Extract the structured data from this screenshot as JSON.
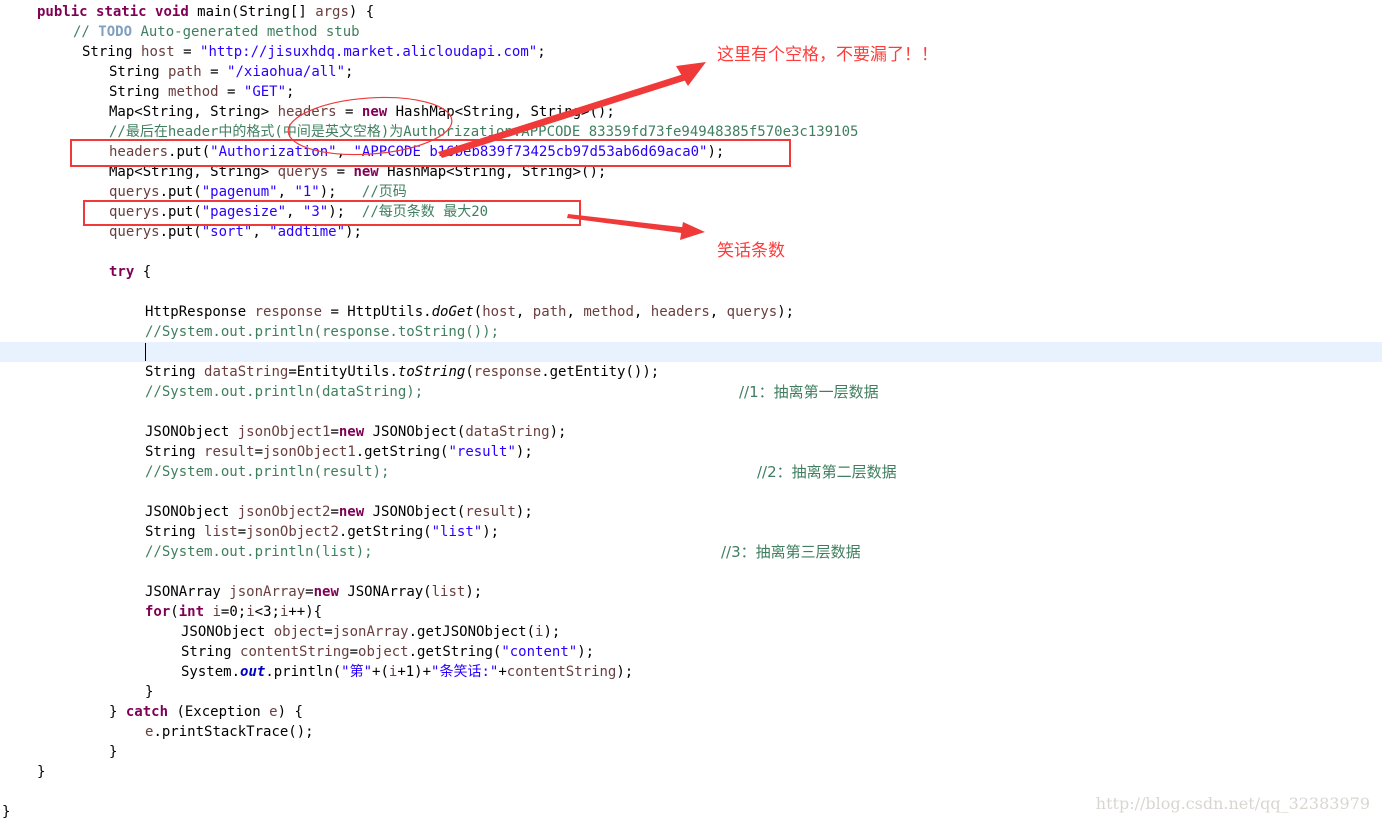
{
  "code": {
    "l1": {
      "kw1": "public",
      "kw2": "static",
      "kw3": "void",
      "rest": " main(String[] ",
      "var": "args",
      "end": ") {"
    },
    "l2": {
      "pre": "// ",
      "todo": "TODO",
      "rest": " Auto-generated method stub"
    },
    "l3": {
      "type": "String ",
      "var": "host",
      "eq": " = ",
      "str": "\"http://jisuxhdq.market.alicloudapi.com\"",
      "end": ";"
    },
    "l4": {
      "type": "String ",
      "var": "path",
      "eq": " = ",
      "str": "\"/xiaohua/all\"",
      "end": ";"
    },
    "l5": {
      "type": "String ",
      "var": "method",
      "eq": " = ",
      "str": "\"GET\"",
      "end": ";"
    },
    "l6": {
      "type": "Map<String, String> ",
      "var": "headers",
      "eq": " = ",
      "kw": "new",
      "rest": " HashMap<String, String>();"
    },
    "l7": {
      "comment": "//最后在header中的格式(中间是英文空格)为Authorization:APPCODE 83359fd73fe94948385f570e3c139105"
    },
    "l8": {
      "var": "headers",
      "call": ".put(",
      "s1": "\"Authorization\"",
      "sep": ", ",
      "s2": "\"APPCODE b16beb839f73425cb97d53ab6d69aca0\"",
      "end": ");"
    },
    "l9": {
      "type": "Map<String, String> ",
      "var": "querys",
      "eq": " = ",
      "kw": "new",
      "rest": " HashMap<String, String>();"
    },
    "l10": {
      "var": "querys",
      "call": ".put(",
      "s1": "\"pagenum\"",
      "sep": ", ",
      "s2": "\"1\"",
      "end": ");   ",
      "comment": "//页码"
    },
    "l11": {
      "var": "querys",
      "call": ".put(",
      "s1": "\"pagesize\"",
      "sep": ", ",
      "s2": "\"3\"",
      "end": ");  ",
      "comment": "//每页条数 最大20"
    },
    "l12": {
      "var": "querys",
      "call": ".put(",
      "s1": "\"sort\"",
      "sep": ", ",
      "s2": "\"addtime\"",
      "end": ");"
    },
    "l14": {
      "kw": "try",
      "rest": " {"
    },
    "l16": {
      "type": "HttpResponse ",
      "var": "response",
      "eq": " = HttpUtils.",
      "it": "doGet",
      "args": "(",
      "a1": "host",
      "c1": ", ",
      "a2": "path",
      "c2": ", ",
      "a3": "method",
      "c3": ", ",
      "a4": "headers",
      "c4": ", ",
      "a5": "querys",
      "end": ");"
    },
    "l17": {
      "comment": "//System.out.println(response.toString());"
    },
    "l19": {
      "type": "String ",
      "var": "dataString",
      "eq": "=EntityUtils.",
      "it": "toString",
      "args": "(",
      "a1": "response",
      "end": ".getEntity());"
    },
    "l20": {
      "comment": "//System.out.println(dataString);",
      "note": "//1：抽离第一层数据"
    },
    "l22": {
      "type": "JSONObject ",
      "var": "jsonObject1",
      "eq": "=",
      "kw": "new",
      "rest": " JSONObject(",
      "a1": "dataString",
      "end": ");"
    },
    "l23": {
      "type": "String ",
      "var": "result",
      "eq": "=",
      "v2": "jsonObject1",
      "rest": ".getString(",
      "str": "\"result\"",
      "end": ");"
    },
    "l24": {
      "comment": "//System.out.println(result);",
      "note": "//2：抽离第二层数据"
    },
    "l26": {
      "type": "JSONObject ",
      "var": "jsonObject2",
      "eq": "=",
      "kw": "new",
      "rest": " JSONObject(",
      "a1": "result",
      "end": ");"
    },
    "l27": {
      "type": "String ",
      "var": "list",
      "eq": "=",
      "v2": "jsonObject2",
      "rest": ".getString(",
      "str": "\"list\"",
      "end": ");"
    },
    "l28": {
      "comment": "//System.out.println(list);",
      "note": "//3：抽离第三层数据"
    },
    "l30": {
      "type": "JSONArray ",
      "var": "jsonArray",
      "eq": "=",
      "kw": "new",
      "rest": " JSONArray(",
      "a1": "list",
      "end": ");"
    },
    "l31": {
      "kw1": "for",
      "p": "(",
      "kw2": "int",
      "rest": " ",
      "v": "i",
      "r2": "=0;",
      "v2": "i",
      "r3": "<3;",
      "v3": "i",
      "end": "++){"
    },
    "l32": {
      "type": "JSONObject ",
      "var": "object",
      "eq": "=",
      "v2": "jsonArray",
      "rest": ".getJSONObject(",
      "a1": "i",
      "end": ");"
    },
    "l33": {
      "type": "String ",
      "var": "contentString",
      "eq": "=",
      "v2": "object",
      "rest": ".getString(",
      "str": "\"content\"",
      "end": ");"
    },
    "l34": {
      "pre": "System.",
      "fld": "out",
      "rest": ".println(",
      "s1": "\"第\"",
      "m1": "+(",
      "v": "i",
      "m2": "+1)+",
      "s2": "\"条笑话:\"",
      "m3": "+",
      "v2": "contentString",
      "end": ");"
    },
    "l35": {
      "text": "}"
    },
    "l36": {
      "pre": "} ",
      "kw": "catch",
      "rest": " (Exception ",
      "v": "e",
      "end": ") {"
    },
    "l37": {
      "v": "e",
      "rest": ".printStackTrace();"
    },
    "l38": {
      "text": "}"
    },
    "l39": {
      "text": "}"
    },
    "l41": {
      "text": "}"
    }
  },
  "annotations": {
    "space_note": "这里有个空格，不要漏了！！",
    "count_note": "笑话条数"
  },
  "watermark": "http://blog.csdn.net/qq_32383979",
  "colors": {
    "keyword": "#7f0055",
    "string": "#2a00ff",
    "comment": "#3f7f5f",
    "annotation_red": "#f03a3a",
    "current_line": "#e8f2fe"
  }
}
